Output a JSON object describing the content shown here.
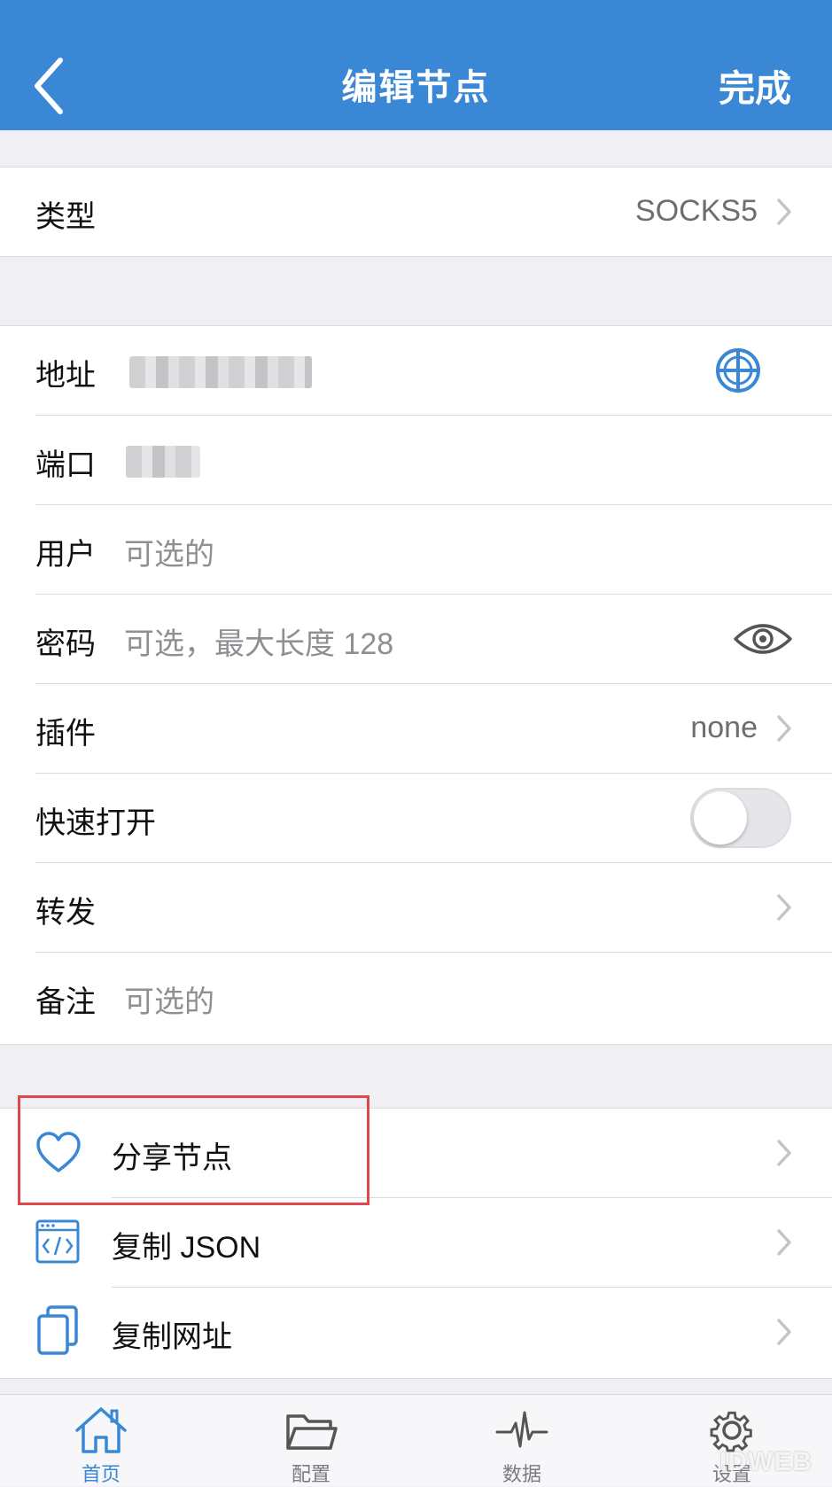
{
  "nav": {
    "title": "编辑节点",
    "done_label": "完成"
  },
  "type_row": {
    "label": "类型",
    "value": "SOCKS5"
  },
  "server": {
    "address_label": "地址",
    "port_label": "端口",
    "user_label": "用户",
    "user_placeholder": "可选的",
    "password_label": "密码",
    "password_placeholder": "可选，最大长度 128",
    "plugin_label": "插件",
    "plugin_value": "none",
    "fast_open_label": "快速打开",
    "fast_open_on": false,
    "forward_label": "转发",
    "note_label": "备注",
    "note_placeholder": "可选的"
  },
  "actions": [
    {
      "label": "分享节点",
      "icon": "heart-icon"
    },
    {
      "label": "复制 JSON",
      "icon": "code-window-icon"
    },
    {
      "label": "复制网址",
      "icon": "copy-icon"
    }
  ],
  "tabbar": [
    {
      "label": "首页",
      "icon": "home-icon",
      "active": true
    },
    {
      "label": "配置",
      "icon": "folder-icon",
      "active": false
    },
    {
      "label": "数据",
      "icon": "pulse-icon",
      "active": false
    },
    {
      "label": "设置",
      "icon": "gear-icon",
      "active": false
    }
  ],
  "watermark": "IDWEB",
  "colors": {
    "accent": "#3a87d6",
    "highlight": "#e0474c",
    "background": "#efeff4"
  }
}
